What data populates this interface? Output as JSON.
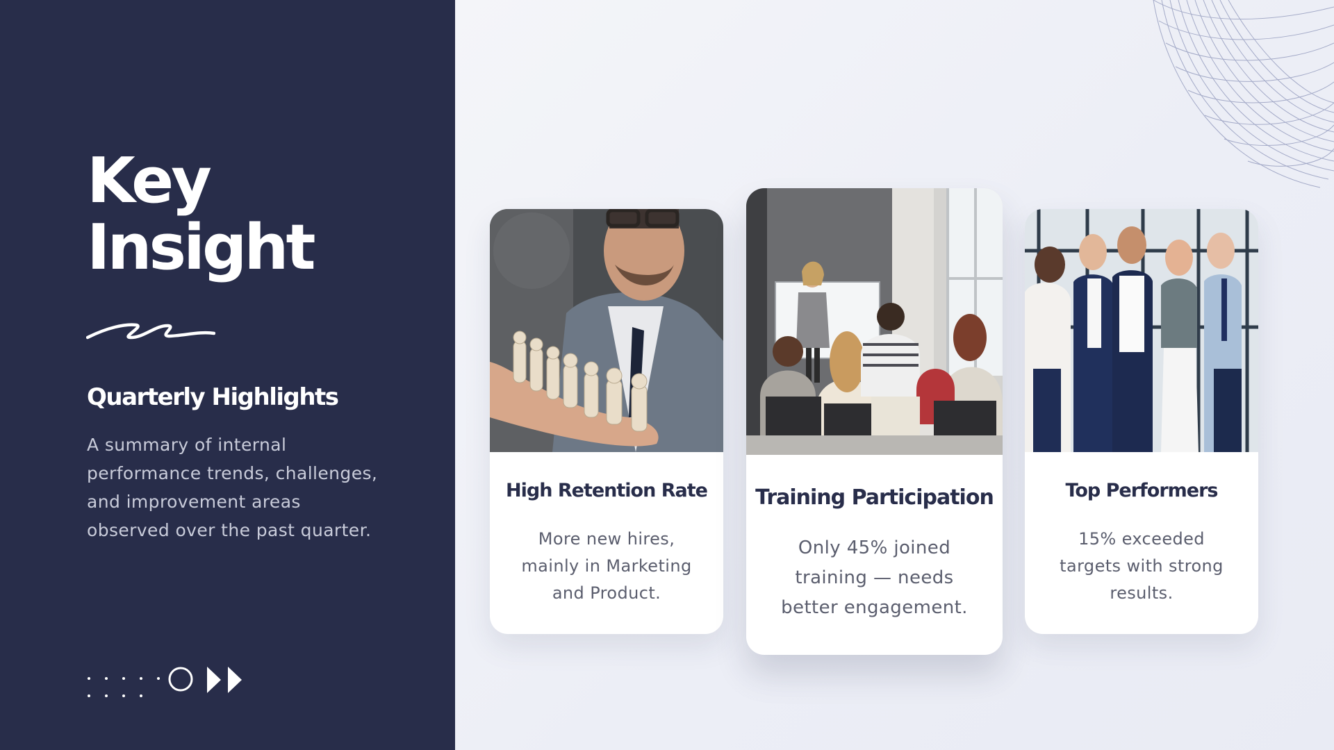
{
  "left": {
    "title_line1": "Key",
    "title_line2": "Insight",
    "subtitle": "Quarterly Highlights",
    "description": "A summary of internal performance trends, challenges, and improvement areas observed over the past quarter."
  },
  "cards": [
    {
      "title": "High Retention Rate",
      "text": "More new hires, mainly in Marketing and Product.",
      "photo": "businessman-holding-figurines-photo"
    },
    {
      "title": "Training Participation",
      "text": "Only 45% joined training — needs better engagement.",
      "photo": "training-session-photo"
    },
    {
      "title": "Top Performers",
      "text": "15% exceeded targets with strong results.",
      "photo": "team-group-photo"
    }
  ],
  "colors": {
    "panel": "#282d4a",
    "background": "#eef0f7",
    "card": "#ffffff",
    "title_text": "#282d4a",
    "body_text": "#5a5d6d"
  },
  "icons": [
    "squiggle-icon",
    "dots-circle-arrows-icon",
    "wireframe-decoration"
  ]
}
